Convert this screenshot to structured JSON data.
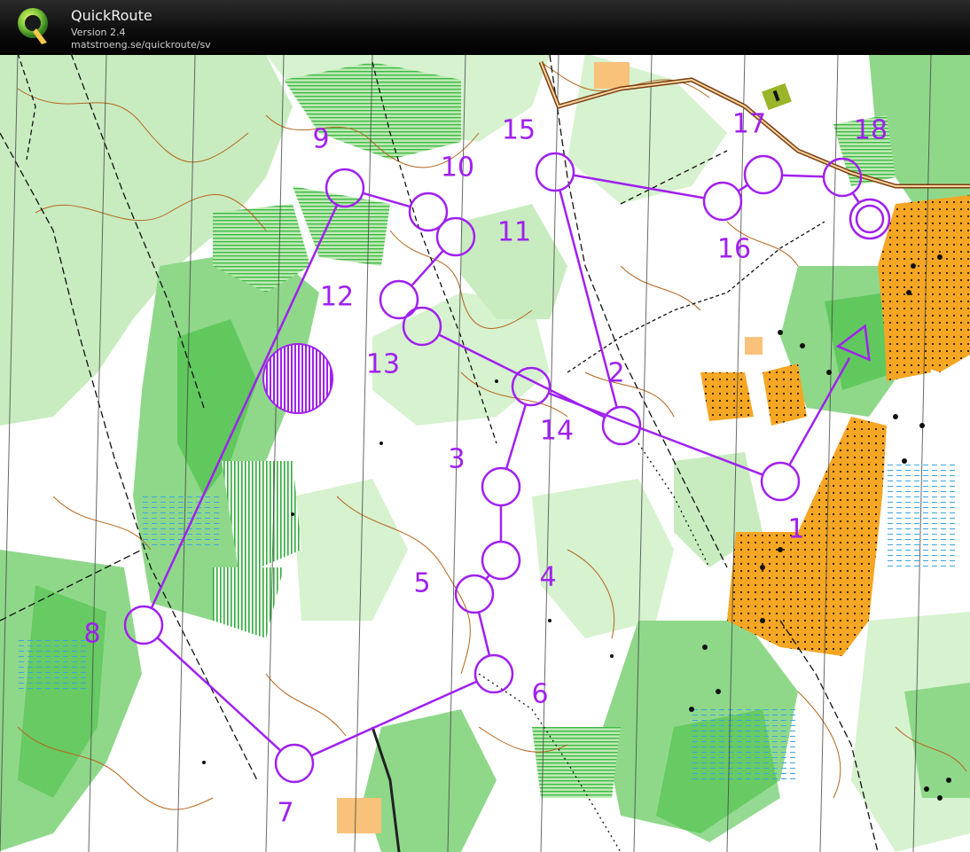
{
  "header": {
    "title": "QuickRoute",
    "version": "Version 2.4",
    "url": "matstroeng.se/quickroute/sv"
  },
  "map": {
    "course_color": "#a020f0",
    "controls": [
      {
        "label": "1"
      },
      {
        "label": "2"
      },
      {
        "label": "3"
      },
      {
        "label": "4"
      },
      {
        "label": "5"
      },
      {
        "label": "6"
      },
      {
        "label": "7"
      },
      {
        "label": "8"
      },
      {
        "label": "9"
      },
      {
        "label": "10"
      },
      {
        "label": "11"
      },
      {
        "label": "12"
      },
      {
        "label": "13"
      },
      {
        "label": "14"
      },
      {
        "label": "15"
      },
      {
        "label": "16"
      },
      {
        "label": "17"
      },
      {
        "label": "18"
      }
    ],
    "colors": {
      "paper": "#ffffff",
      "forest_light": "#c8ecc0",
      "forest_mid": "#8fd88a",
      "forest_dark": "#4cc24a",
      "open": "#f5a623",
      "contour": "#b5651d",
      "track": "#000000",
      "road": "#7a3b10",
      "water": "#6fc3ee"
    }
  }
}
